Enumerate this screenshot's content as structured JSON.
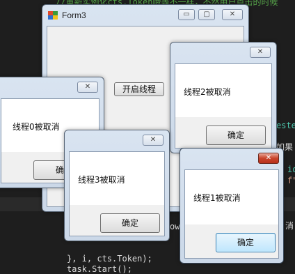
{
  "editor": {
    "lines": [
      "//重新实例化cts.Token哦等不一样，不然用户点击的时候",
      "este",
      "如果",
      ")",
      "io",
      "f\"",
      "消\"",
      "ow",
      "}, i, cts.Token);",
      "task.Start();"
    ]
  },
  "form3": {
    "title": "Form3",
    "start_button": "开启线程"
  },
  "dialogs": [
    {
      "message": "线程0被取消",
      "ok": "确定"
    },
    {
      "message": "线程2被取消",
      "ok": "确定"
    },
    {
      "message": "线程3被取消",
      "ok": "确定"
    },
    {
      "message": "线程1被取消",
      "ok": "确定"
    }
  ],
  "window_controls": {
    "minimize": "▭",
    "maximize": "▢",
    "close": "✕"
  }
}
